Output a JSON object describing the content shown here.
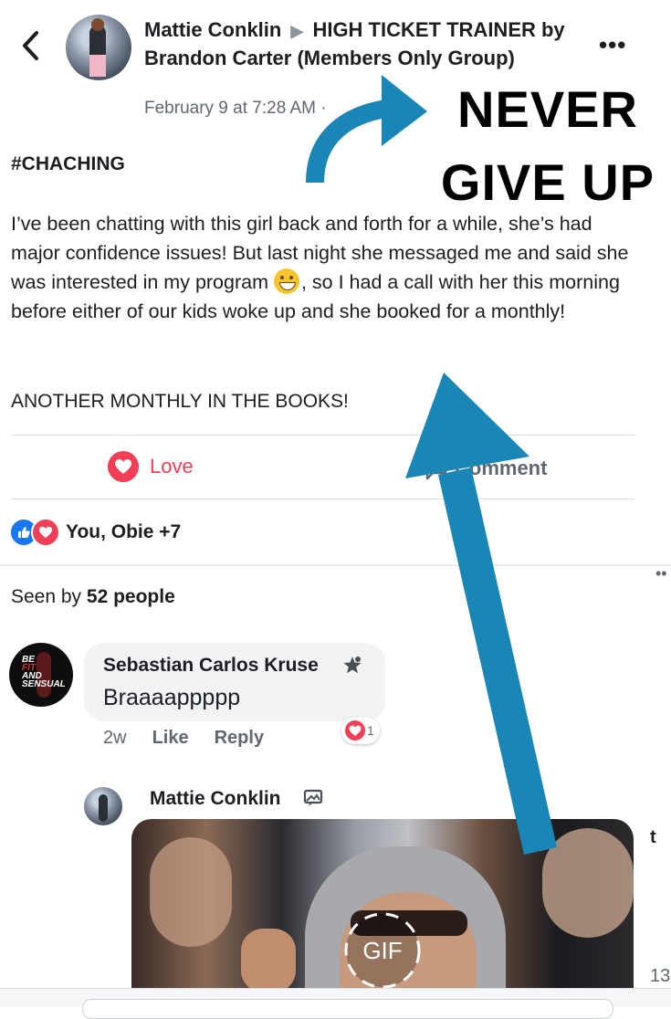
{
  "header": {
    "author": "Mattie Conklin",
    "group": "HIGH TICKET TRAINER by Brandon Carter (Members Only Group)",
    "date": "February 9 at 7:28 AM ·"
  },
  "post": {
    "hashtag": "#CHACHING",
    "body_part1": "I’ve been chatting with this girl back and forth for a while, she’s had major confidence issues! But last night she messaged me and said she was interested in my program ",
    "body_part2": ", so I had a call with her this morning before either of our kids woke up and she booked for a monthly!",
    "another": "ANOTHER MONTHLY IN THE BOOKS!"
  },
  "actions": {
    "love_label": "Love",
    "comment_label": "Comment"
  },
  "reactions": {
    "summary": "You, Obie +7"
  },
  "seen": {
    "prefix": "Seen by ",
    "count": "52 people"
  },
  "comment": {
    "author": "Sebastian Carlos Kruse",
    "text": "Braaaappppp",
    "time": "2w",
    "like": "Like",
    "reply": "Reply",
    "reaction_count": "1",
    "avatar_text": "BE FIT AND SENSUAL"
  },
  "reply": {
    "author": "Mattie Conklin",
    "gif_label": "GIF"
  },
  "edge": {
    "t": "t",
    "num": "13"
  },
  "overlay": {
    "line1": "NEVER",
    "line2": "GIVE UP",
    "arrow_color": "#1a86b6"
  },
  "colors": {
    "love": "#f33e58",
    "like": "#1877f2",
    "secondary_text": "#606770"
  }
}
